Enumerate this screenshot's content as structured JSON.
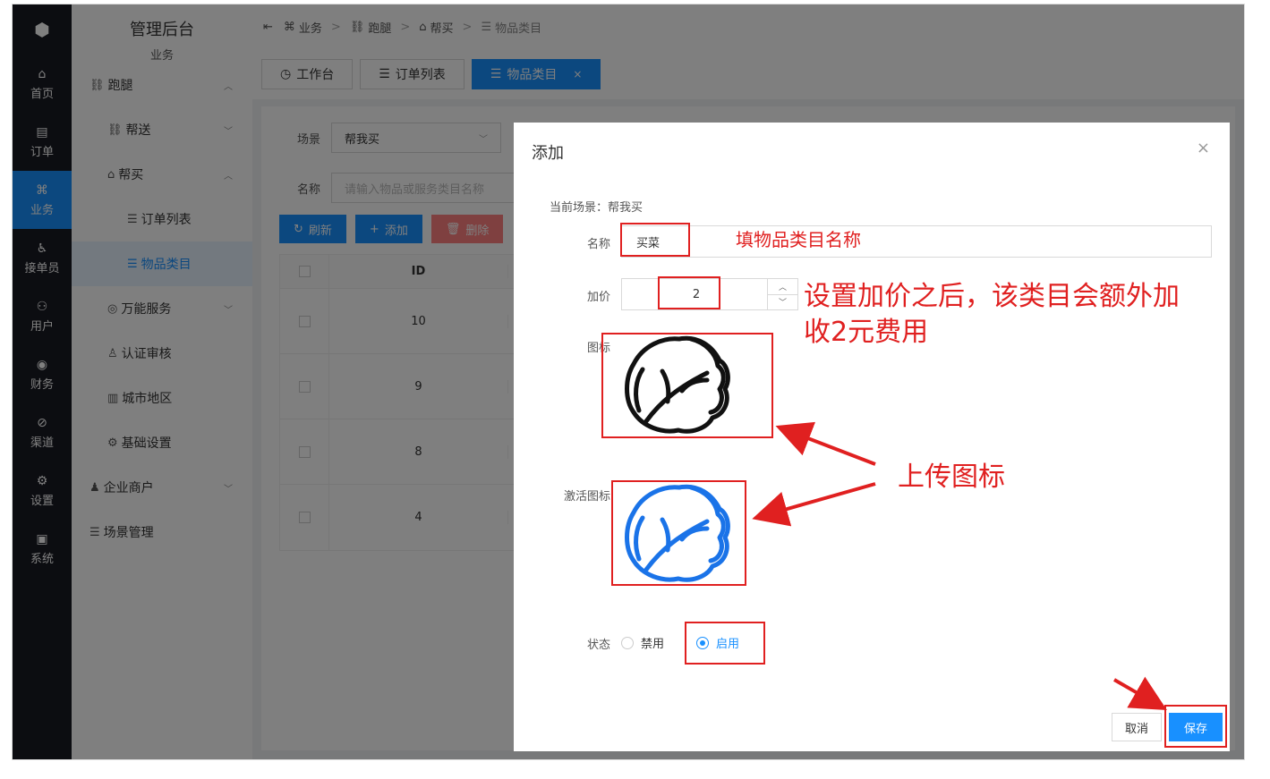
{
  "rail": {
    "items": [
      {
        "label": "首页",
        "icon": "⌂"
      },
      {
        "label": "订单",
        "icon": "▤"
      },
      {
        "label": "业务",
        "icon": "⌘"
      },
      {
        "label": "接单员",
        "icon": "♿"
      },
      {
        "label": "用户",
        "icon": "⚇"
      },
      {
        "label": "财务",
        "icon": "◉"
      },
      {
        "label": "渠道",
        "icon": "⊘"
      },
      {
        "label": "设置",
        "icon": "⚙"
      },
      {
        "label": "系统",
        "icon": "▣"
      }
    ]
  },
  "menu": {
    "app_title": "管理后台",
    "app_sub": "业务",
    "items": [
      {
        "label": "跑腿",
        "icon": "⛓"
      },
      {
        "label": "帮送",
        "icon": "⛓"
      },
      {
        "label": "帮买",
        "icon": "⌂"
      },
      {
        "label": "订单列表",
        "icon": "☰"
      },
      {
        "label": "物品类目",
        "icon": "☰"
      },
      {
        "label": "万能服务",
        "icon": "◎"
      },
      {
        "label": "认证审核",
        "icon": "♙"
      },
      {
        "label": "城市地区",
        "icon": "▥"
      },
      {
        "label": "基础设置",
        "icon": "⚙"
      },
      {
        "label": "企业商户",
        "icon": "♟"
      },
      {
        "label": "场景管理",
        "icon": "☰"
      }
    ]
  },
  "breadcrumb": [
    "业务",
    "跑腿",
    "帮买",
    "物品类目"
  ],
  "tabs": [
    {
      "label": "工作台"
    },
    {
      "label": "订单列表"
    },
    {
      "label": "物品类目",
      "close": "×"
    }
  ],
  "filters": {
    "scene_label": "场景",
    "scene_value": "帮我买",
    "name_label": "名称",
    "name_placeholder": "请输入物品或服务类目名称"
  },
  "toolbar": {
    "refresh": "刷新",
    "add": "添加",
    "delete": "删除"
  },
  "table": {
    "id_header": "ID",
    "rows": [
      "10",
      "9",
      "8",
      "4"
    ]
  },
  "dialog": {
    "title": "添加",
    "close": "×",
    "scene_text": "当前场景：帮我买",
    "name_label": "名称",
    "name_value": "买菜",
    "price_label": "加价",
    "price_value": "2",
    "icon_label": "图标",
    "active_icon_label": "激活图标",
    "status_label": "状态",
    "status_options": [
      "禁用",
      "启用"
    ],
    "status_selected": "启用",
    "cancel": "取消",
    "save": "保存"
  },
  "annotations": {
    "name_hint": "填物品类目名称",
    "price_hint_1": "设置加价之后，该类目会额外加",
    "price_hint_2": "收2元费用",
    "upload_hint": "上传图标"
  },
  "colors": {
    "accent": "#1890ff",
    "annotation": "#e02020",
    "rail": "#191a23"
  }
}
